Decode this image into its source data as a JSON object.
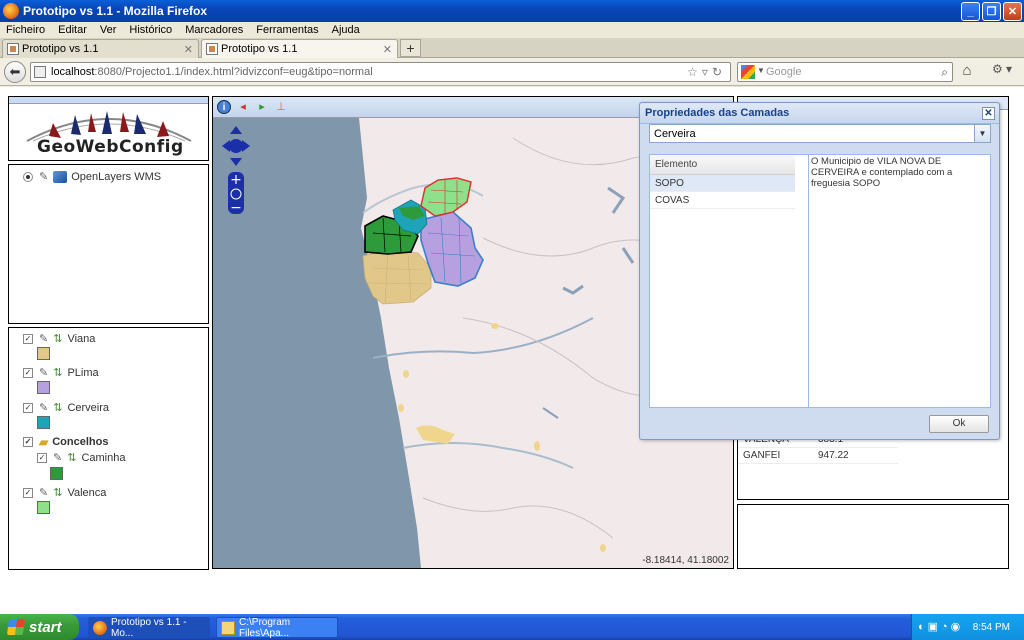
{
  "window": {
    "title": "Prototipo vs 1.1 - Mozilla Firefox"
  },
  "menu": [
    "Ficheiro",
    "Editar",
    "Ver",
    "Histórico",
    "Marcadores",
    "Ferramentas",
    "Ajuda"
  ],
  "tabs": [
    {
      "label": "Prototipo vs 1.1"
    },
    {
      "label": "Prototipo vs 1.1"
    }
  ],
  "url": {
    "host": "localhost",
    "path": ":8080/Projecto1.1/index.html?idvizconf=eug&tipo=normal"
  },
  "search": {
    "placeholder": "Google"
  },
  "logo": {
    "text": "GeoWebConfig"
  },
  "baselayers": [
    {
      "label": "OpenLayers WMS"
    }
  ],
  "layers": [
    {
      "label": "Viana",
      "color": "#e1c78a"
    },
    {
      "label": "PLima",
      "color": "#b7a0e0"
    },
    {
      "label": "Cerveira",
      "color": "#1fa3b8"
    },
    {
      "label": "Concelhos",
      "folder": true
    },
    {
      "label": "Caminha",
      "color": "#2d9b3a"
    },
    {
      "label": "Valenca",
      "color": "#8fe08a",
      "border": "#d9302a"
    }
  ],
  "map": {
    "coords": "-8.18414, 41.18002"
  },
  "right_table": [
    {
      "name": "VALENÇA",
      "value": "383.1"
    },
    {
      "name": "GANFEI",
      "value": "947.22"
    }
  ],
  "dialog": {
    "title": "Propriedades das Camadas",
    "combo_value": "Cerveira",
    "grid_header": "Elemento",
    "rows": [
      "SOPO",
      "COVAS"
    ],
    "description": "O Municipio de VILA NOVA DE CERVEIRA e contemplado com a freguesia SOPO",
    "ok_label": "Ok"
  },
  "taskbar": {
    "start": "start",
    "tasks": [
      "Prototipo vs 1.1 - Mo...",
      "C:\\Program Files\\Apa..."
    ],
    "clock": "8:54 PM"
  }
}
